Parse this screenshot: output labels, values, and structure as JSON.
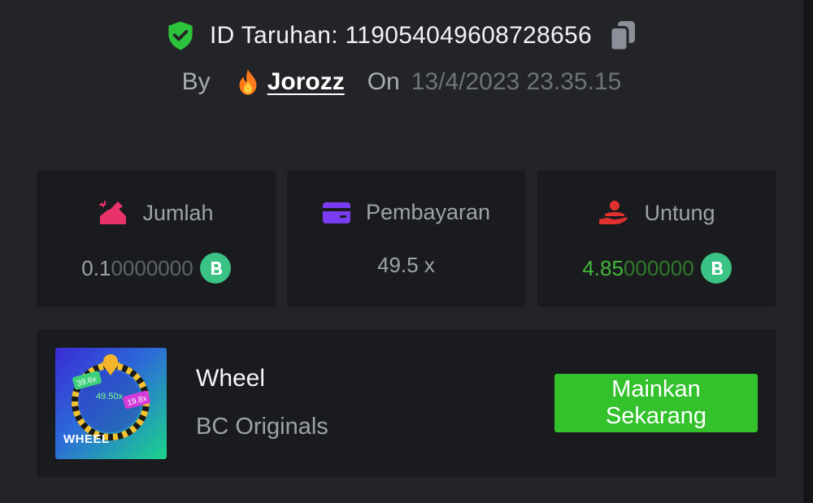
{
  "bet": {
    "id_label": "ID Taruhan: 119054049608728656",
    "by_label": "By",
    "username": "Jorozz",
    "on_label": "On",
    "date": "13/4/2023 23.35.15"
  },
  "stats": [
    {
      "label": "Jumlah",
      "value_main": "0.1",
      "value_dim": "0000000",
      "icon": "bet-amount-icon"
    },
    {
      "label": "Pembayaran",
      "value_main": "49.5 x",
      "value_dim": "",
      "icon": "card-icon"
    },
    {
      "label": "Untung",
      "value_main": "4.85",
      "value_dim": "000000",
      "icon": "profit-icon"
    }
  ],
  "game": {
    "thumbnail_label": "WHEEL",
    "thumbnail_tags": [
      "39.6x",
      "49.50x",
      "19.8x"
    ],
    "name": "Wheel",
    "provider": "BC Originals",
    "play_label": "Mainkan\nSekarang"
  },
  "colors": {
    "background": "#232427",
    "card": "#1a1b1e",
    "accent_green": "#33c12c",
    "profit_green": "#42b83a",
    "coin": "#3bc285",
    "shield": "#2bc23c",
    "amount_icon": "#e8336a",
    "payout_icon": "#7a3cf0",
    "profit_icon": "#e0312f"
  }
}
